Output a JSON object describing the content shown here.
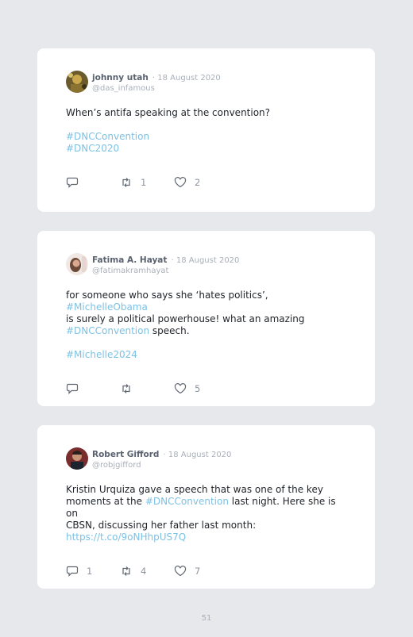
{
  "tweets": [
    {
      "name": "johnny utah",
      "date": "· 18 August 2020",
      "handle": "@das_infamous",
      "text": "When’s antifa speaking at the convention?",
      "hashtags": [
        "#DNCConvention",
        "#DNC2020"
      ],
      "replies": "",
      "retweets": "1",
      "likes": "2"
    },
    {
      "name": "Fatima A. Hayat",
      "date": "· 18 August 2020",
      "handle": "@fatimakramhayat",
      "text_line1_a": "for someone who says she ‘hates politics’,",
      "text_line1_tag": "#MichelleObama",
      "text_line2": "is surely a political powerhouse! what an amazing",
      "text_line3_tag": "#DNCConvention",
      "text_line3_b": "speech.",
      "hashtag": "#Michelle2024",
      "replies": "",
      "retweets": "",
      "likes": "5"
    },
    {
      "name": "Robert Gifford",
      "date": "· 18 August 2020",
      "handle": "@robjgifford",
      "text_line1": "Kristin Urquiza gave a speech that was one of the key",
      "text_line2_a": "moments at the",
      "text_line2_tag": "#DNCConvention",
      "text_line2_b": "last night. Here she is on",
      "text_line3": "CBSN, discussing her father last month:",
      "link": "https://t.co/9oNHhpUS7Q",
      "replies": "1",
      "retweets": "4",
      "likes": "7"
    }
  ],
  "page_number": "51",
  "icons": {
    "reply": "reply-icon",
    "retweet": "retweet-icon",
    "like": "heart-icon"
  },
  "colors": {
    "background": "#e6e8ec",
    "hashtag": "#7cc1e4"
  }
}
